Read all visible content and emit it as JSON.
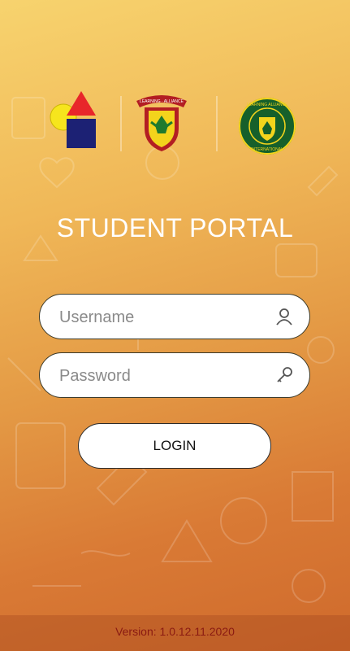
{
  "logos": {
    "logo1": "shapes-logo-icon",
    "logo2": "learning-alliance-crest-icon",
    "logo3": "learning-alliance-international-seal-icon"
  },
  "title": "STUDENT PORTAL",
  "username": {
    "placeholder": "Username",
    "value": "",
    "icon": "user-icon"
  },
  "password": {
    "placeholder": "Password",
    "value": "",
    "icon": "key-icon"
  },
  "login_label": "LOGIN",
  "footer": {
    "version": "Version: 1.0.12.11.2020"
  },
  "colors": {
    "accent_text": "#8a1a12",
    "background_top": "#f7d36e",
    "background_bottom": "#cf6a2c"
  }
}
